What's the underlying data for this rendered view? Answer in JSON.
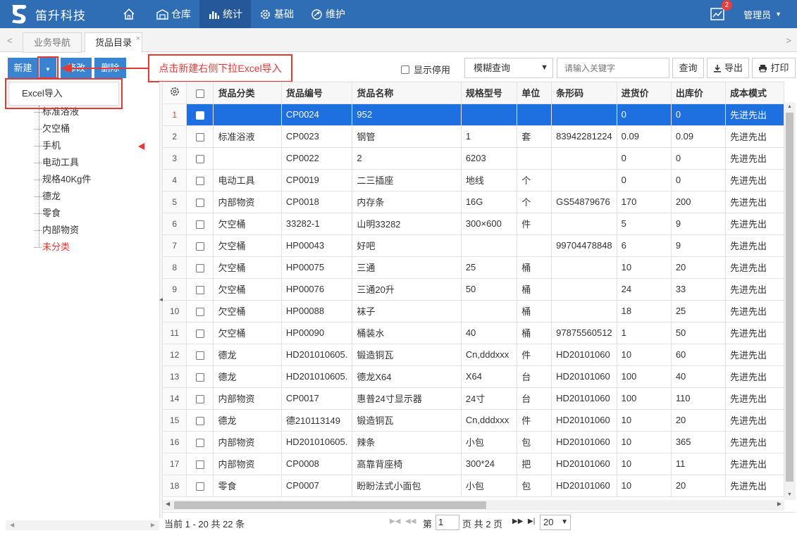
{
  "app": {
    "title": "笛升科技",
    "nav": [
      "仓库",
      "统计",
      "基础",
      "维护"
    ],
    "notification_count": "2",
    "user": "管理员"
  },
  "tabs": [
    "业务导航",
    "货品目录"
  ],
  "toolbar": {
    "new_label": "新建",
    "edit_label": "修改",
    "delete_label": "删除",
    "callout": "点击新建右侧下拉Excel导入",
    "show_disabled": "显示停用",
    "search_mode": "模糊查询",
    "search_placeholder": "请输入关键字",
    "query_label": "查询",
    "export_label": "导出",
    "print_label": "打印"
  },
  "dropdown": {
    "excel_import": "Excel导入"
  },
  "tree": [
    "标准浴液",
    "欠空桶",
    "手机",
    "电动工具",
    "规格40Kg件",
    "德龙",
    "零食",
    "内部物资",
    "未分类"
  ],
  "grid": {
    "columns": [
      "货品分类",
      "货品编号",
      "货品名称",
      "规格型号",
      "单位",
      "条形码",
      "进货价",
      "出库价",
      "成本模式"
    ],
    "rows": [
      [
        "1",
        "",
        "CP0024",
        "952",
        "",
        "",
        "",
        "0",
        "0",
        "先进先出"
      ],
      [
        "2",
        "标准浴液",
        "CP0023",
        "钢管",
        "1",
        "套",
        "83942281224",
        "0.09",
        "0.09",
        "先进先出"
      ],
      [
        "3",
        "",
        "CP0022",
        "2",
        "6203",
        "",
        "",
        "0",
        "0",
        "先进先出"
      ],
      [
        "4",
        "电动工具",
        "CP0019",
        "二三插座",
        "地线",
        "个",
        "",
        "0",
        "0",
        "先进先出"
      ],
      [
        "5",
        "内部物资",
        "CP0018",
        "内存条",
        "16G",
        "个",
        "GS54879676",
        "170",
        "200",
        "先进先出"
      ],
      [
        "6",
        "欠空桶",
        "33282-1",
        "山明33282",
        "300×600",
        "件",
        "",
        "5",
        "9",
        "先进先出"
      ],
      [
        "7",
        "欠空桶",
        "HP00043",
        "好吧",
        "",
        "",
        "99704478848",
        "6",
        "9",
        "先进先出"
      ],
      [
        "8",
        "欠空桶",
        "HP00075",
        "三通",
        "25",
        "桶",
        "",
        "10",
        "20",
        "先进先出"
      ],
      [
        "9",
        "欠空桶",
        "HP00076",
        "三通20升",
        "50",
        "桶",
        "",
        "24",
        "33",
        "先进先出"
      ],
      [
        "10",
        "欠空桶",
        "HP00088",
        "袜子",
        "",
        "桶",
        "",
        "18",
        "25",
        "先进先出"
      ],
      [
        "11",
        "欠空桶",
        "HP00090",
        "桶装水",
        "40",
        "桶",
        "97875560512",
        "1",
        "50",
        "先进先出"
      ],
      [
        "12",
        "德龙",
        "HD201010605.",
        "锻造铜瓦",
        "Cn,dddxxx",
        "件",
        "HD20101060",
        "10",
        "60",
        "先进先出"
      ],
      [
        "13",
        "德龙",
        "HD201010605.",
        "德龙X64",
        "X64",
        "台",
        "HD20101060",
        "100",
        "40",
        "先进先出"
      ],
      [
        "14",
        "内部物资",
        "CP0017",
        "惠普24寸显示器",
        "24寸",
        "台",
        "HD20101060",
        "100",
        "110",
        "先进先出"
      ],
      [
        "15",
        "德龙",
        "德210113149",
        "锻造铜瓦",
        "Cn,dddxxx",
        "件",
        "HD20101060",
        "10",
        "20",
        "先进先出"
      ],
      [
        "16",
        "内部物资",
        "HD201010605.",
        "辣条",
        "小包",
        "包",
        "HD20101060",
        "10",
        "365",
        "先进先出"
      ],
      [
        "17",
        "内部物资",
        "CP0008",
        "高靠背座椅",
        "300*24",
        "把",
        "HD20101060",
        "10",
        "11",
        "先进先出"
      ],
      [
        "18",
        "零食",
        "CP0007",
        "盼盼法式小面包",
        "小包",
        "包",
        "HD20101060",
        "10",
        "20",
        "先进先出"
      ]
    ]
  },
  "pager": {
    "info": "当前 1 - 20 共 22 条",
    "page_prefix": "第",
    "page_value": "1",
    "page_suffix": "页 共 2 页",
    "page_size": "20"
  }
}
